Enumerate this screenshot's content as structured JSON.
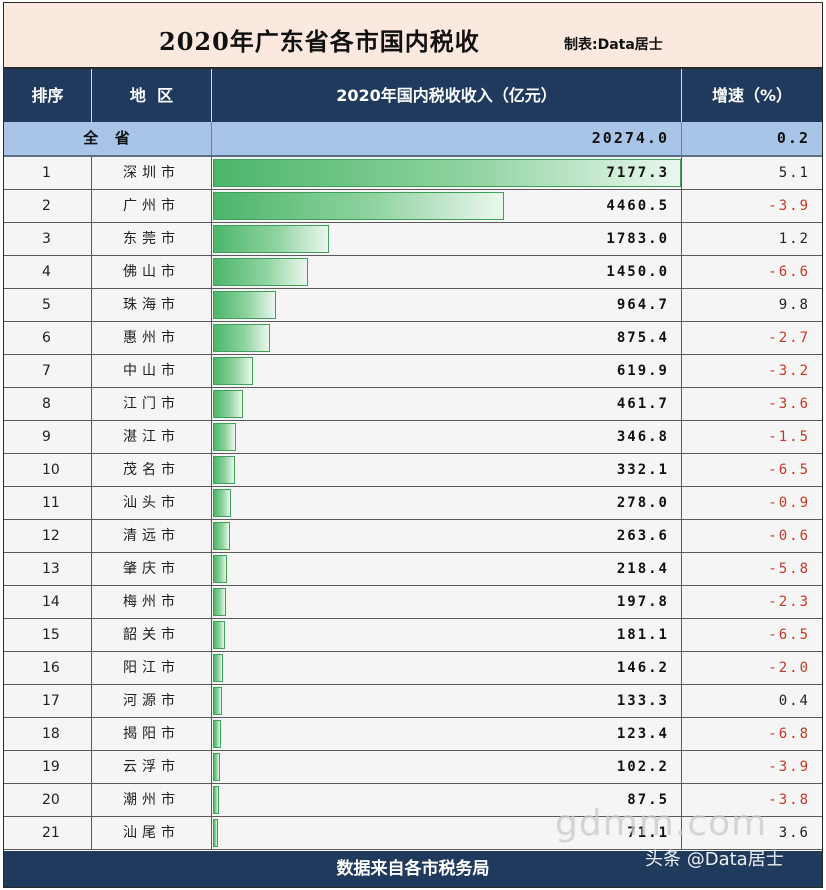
{
  "title": "2020年广东省各市国内税收",
  "credit": "制表:Data居士",
  "columns": {
    "rank": "排序",
    "region": "地  区",
    "revenue": "2020年国内税收收入（亿元）",
    "growth": "增速（%）"
  },
  "total": {
    "label": "全  省",
    "revenue": "20274.0",
    "growth": "0.2"
  },
  "footer": "数据来自各市税务局",
  "watermark": "gdmm.com",
  "source_tag": "头条 @Data居士",
  "colors": {
    "bar": "#4cb66a",
    "header": "#1f3a5c",
    "negative": "#c0392b"
  },
  "chart_data": {
    "type": "bar",
    "orientation": "horizontal",
    "title": "2020年广东省各市国内税收",
    "categories": [
      "深圳市",
      "广州市",
      "东莞市",
      "佛山市",
      "珠海市",
      "惠州市",
      "中山市",
      "江门市",
      "湛江市",
      "茂名市",
      "汕头市",
      "清远市",
      "肇庆市",
      "梅州市",
      "韶关市",
      "阳江市",
      "河源市",
      "揭阳市",
      "云浮市",
      "潮州市",
      "汕尾市"
    ],
    "ranks": [
      "1",
      "2",
      "3",
      "4",
      "5",
      "6",
      "7",
      "8",
      "9",
      "10",
      "11",
      "12",
      "13",
      "14",
      "15",
      "16",
      "17",
      "18",
      "19",
      "20",
      "21"
    ],
    "values": [
      7177.3,
      4460.5,
      1783.0,
      1450.0,
      964.7,
      875.4,
      619.9,
      461.7,
      346.8,
      332.1,
      278.0,
      263.6,
      218.4,
      197.8,
      181.1,
      146.2,
      133.3,
      123.4,
      102.2,
      87.5,
      71.1
    ],
    "value_labels": [
      "7177.3",
      "4460.5",
      "1783.0",
      "1450.0",
      "964.7",
      "875.4",
      "619.9",
      "461.7",
      "346.8",
      "332.1",
      "278.0",
      "263.6",
      "218.4",
      "197.8",
      "181.1",
      "146.2",
      "133.3",
      "123.4",
      "102.2",
      "87.5",
      "71.1"
    ],
    "growth": [
      "5.1",
      "-3.9",
      "1.2",
      "-6.6",
      "9.8",
      "-2.7",
      "-3.2",
      "-3.6",
      "-1.5",
      "-6.5",
      "-0.9",
      "-0.6",
      "-5.8",
      "-2.3",
      "-6.5",
      "-2.0",
      "0.4",
      "-6.8",
      "-3.9",
      "-3.8",
      "3.6"
    ],
    "xlim": [
      0,
      7177.3
    ]
  }
}
